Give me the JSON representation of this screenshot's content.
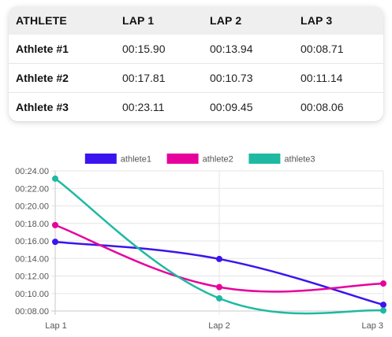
{
  "table": {
    "headers": [
      "ATHLETE",
      "LAP 1",
      "LAP 2",
      "LAP 3"
    ],
    "rows": [
      {
        "athlete": "Athlete #1",
        "lap1": "00:15.90",
        "lap2": "00:13.94",
        "lap3": "00:08.71"
      },
      {
        "athlete": "Athlete #2",
        "lap1": "00:17.81",
        "lap2": "00:10.73",
        "lap3": "00:11.14"
      },
      {
        "athlete": "Athlete #3",
        "lap1": "00:23.11",
        "lap2": "00:09.45",
        "lap3": "00:08.06"
      }
    ]
  },
  "chart_data": {
    "type": "line",
    "categories": [
      "Lap 1",
      "Lap 2",
      "Lap 3"
    ],
    "series": [
      {
        "name": "athlete1",
        "color": "#3c14ee",
        "values": [
          15.9,
          13.94,
          8.71
        ]
      },
      {
        "name": "athlete2",
        "color": "#e6009c",
        "values": [
          17.81,
          10.73,
          11.14
        ]
      },
      {
        "name": "athlete3",
        "color": "#1fb9a2",
        "values": [
          23.11,
          9.45,
          8.06
        ]
      }
    ],
    "ylim": [
      8,
      24
    ],
    "y_ticks": [
      "00:08.00",
      "00:10.00",
      "00:12.00",
      "00:14.00",
      "00:16.00",
      "00:18.00",
      "00:20.00",
      "00:22.00",
      "00:24.00"
    ],
    "grid": true,
    "legend_position": "top-center",
    "title": "",
    "xlabel": "",
    "ylabel": ""
  }
}
